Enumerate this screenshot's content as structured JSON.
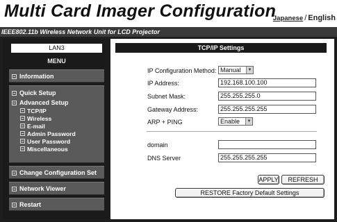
{
  "app": {
    "title": "Multi Card Imager Configuration",
    "lang_japanese": "Japanese",
    "lang_sep": "/",
    "lang_english": "English",
    "subtitle": "IEEE802.11b Wireless Network Unit for LCD Projector"
  },
  "sidebar": {
    "lan": "LAN3",
    "menu_title": "MENU",
    "sections": [
      {
        "label": "Information"
      },
      {
        "label": "Quick Setup"
      },
      {
        "label": "Advanced Setup"
      },
      {
        "label": "Change Configuration Set"
      },
      {
        "label": "Network Viewer"
      },
      {
        "label": "Restart"
      }
    ],
    "advanced_items": [
      {
        "label": "TCP/IP"
      },
      {
        "label": "Wireless"
      },
      {
        "label": "E-mail"
      },
      {
        "label": "Admin Password"
      },
      {
        "label": "User Password"
      },
      {
        "label": "Miscellaneous"
      }
    ]
  },
  "main": {
    "header": "TCP/IP Settings",
    "fields": {
      "ip_method": {
        "label": "IP Configuration Method:",
        "value": "Manual"
      },
      "ip_address": {
        "label": "IP Address:",
        "value": "192.168.100.100"
      },
      "subnet_mask": {
        "label": "Subnet Mask:",
        "value": "255.255.255.0"
      },
      "gateway": {
        "label": "Gateway Address:",
        "value": "255.255.255.255"
      },
      "arp_ping": {
        "label": "ARP + PING",
        "value": "Enable"
      },
      "domain": {
        "label": "domain",
        "value": ""
      },
      "dns": {
        "label": "DNS Server",
        "value": "255.255.255.255"
      }
    },
    "buttons": {
      "apply": "APPLY",
      "refresh": "REFRESH",
      "restore": "RESTORE Factory Default Settings"
    }
  }
}
